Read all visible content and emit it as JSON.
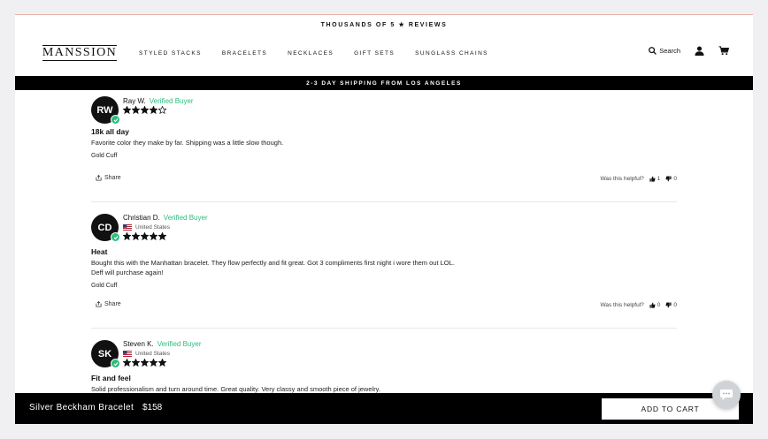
{
  "announcement": "THOUSANDS OF 5 ★ REVIEWS",
  "brand": {
    "logo_text": "MANSSION"
  },
  "nav": [
    "STYLED STACKS",
    "BRACELETS",
    "NECKLACES",
    "GIFT SETS",
    "SUNGLASS CHAINS"
  ],
  "header": {
    "search_label": "Search",
    "icons": [
      "search-icon",
      "account-icon",
      "cart-icon"
    ]
  },
  "shipping_banner": "2-3 DAY SHIPPING FROM LOS ANGELES",
  "reviews": [
    {
      "initials": "RW",
      "name": "Ray W.",
      "verified": "Verified Buyer",
      "country": "",
      "rating": 4,
      "title": "18k all day",
      "body": "Favorite color they make by far. Shipping was a little slow though.",
      "body2": "",
      "product": "Gold Cuff",
      "share": "Share",
      "helpful_label": "Was this helpful?",
      "up": "1",
      "down": "0"
    },
    {
      "initials": "CD",
      "name": "Christian D.",
      "verified": "Verified Buyer",
      "country": "United States",
      "rating": 5,
      "title": "Heat",
      "body": "Bought this with the Manhattan bracelet. They flow perfectly and fit great. Got 3 compliments first night i wore them out LOL.",
      "body2": "Deff will purchase again!",
      "product": "Gold Cuff",
      "share": "Share",
      "helpful_label": "Was this helpful?",
      "up": "0",
      "down": "0"
    },
    {
      "initials": "SK",
      "name": "Steven K.",
      "verified": "Verified Buyer",
      "country": "United States",
      "rating": 5,
      "title": "Fit and feel",
      "body": "Solid professionalism and turn around time. Great quality. Very classy and smooth piece of jewelry.",
      "body2": "",
      "product": "",
      "share": "",
      "helpful_label": "",
      "up": "",
      "down": ""
    }
  ],
  "sticky_bar": {
    "product_name": "Silver Beckham Bracelet",
    "price": "$158",
    "button": "ADD TO CART"
  },
  "colors": {
    "verified_green": "#2bbd7e",
    "bar_black": "#000000"
  }
}
